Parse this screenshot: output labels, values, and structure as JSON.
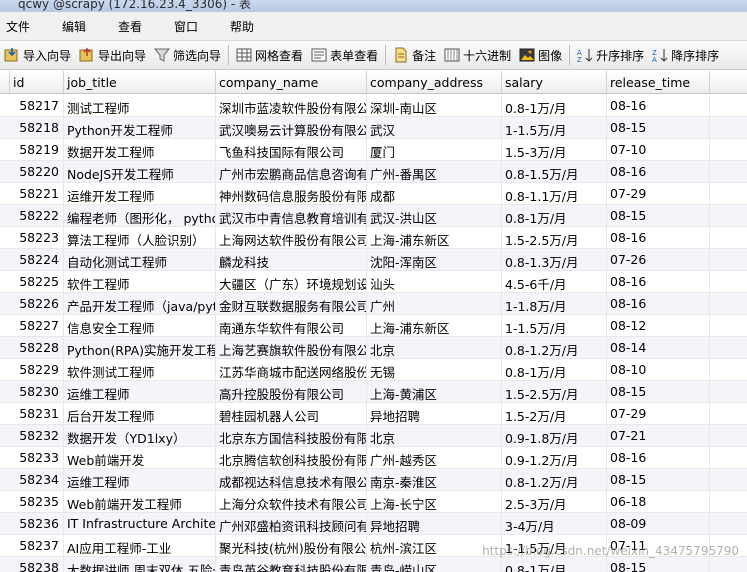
{
  "window": {
    "title": "qcwy @scrapy (172.16.23.4_3306) - 表"
  },
  "menu": [
    "文件",
    "编辑",
    "查看",
    "窗口",
    "帮助"
  ],
  "toolbar": [
    {
      "name": "import-wizard",
      "label": "导入向导",
      "icon": "import-icon"
    },
    {
      "name": "export-wizard",
      "label": "导出向导",
      "icon": "export-icon"
    },
    {
      "name": "filter-wizard",
      "label": "筛选向导",
      "icon": "filter-icon"
    },
    {
      "name": "grid-view",
      "label": "网格查看",
      "icon": "grid-icon"
    },
    {
      "name": "form-view",
      "label": "表单查看",
      "icon": "form-icon"
    },
    {
      "name": "memo",
      "label": "备注",
      "icon": "memo-icon"
    },
    {
      "name": "hex",
      "label": "十六进制",
      "icon": "hex-icon"
    },
    {
      "name": "image",
      "label": "图像",
      "icon": "image-icon"
    },
    {
      "name": "sort-asc",
      "label": "升序排序",
      "icon": "sort-asc-icon"
    },
    {
      "name": "sort-desc",
      "label": "降序排序",
      "icon": "sort-desc-icon"
    }
  ],
  "table": {
    "columns": [
      "id",
      "job_title",
      "company_name",
      "company_address",
      "salary",
      "release_time"
    ],
    "rows": [
      [
        "58217",
        "测试工程师",
        "深圳市蓝凌软件股份有限公司",
        "深圳-南山区",
        "0.8-1万/月",
        "08-16"
      ],
      [
        "58218",
        "Python开发工程师",
        "武汉噢易云计算股份有限公司",
        "武汉",
        "1-1.5万/月",
        "08-15"
      ],
      [
        "58219",
        "数据开发工程师",
        "飞鱼科技国际有限公司",
        "厦门",
        "1.5-3万/月",
        "07-10"
      ],
      [
        "58220",
        "NodeJS开发工程师",
        "广州市宏鹏商品信息咨询有限公司",
        "广州-番禺区",
        "0.8-1.5万/月",
        "08-16"
      ],
      [
        "58221",
        "运维开发工程师",
        "神州数码信息服务股份有限公司",
        "成都",
        "0.8-1.1万/月",
        "07-29"
      ],
      [
        "58222",
        "编程老师（图形化， python",
        "武汉市中青信息教育培训有限公司",
        "武汉-洪山区",
        "0.8-1万/月",
        "08-15"
      ],
      [
        "58223",
        "算法工程师（人脸识别）",
        "上海网达软件股份有限公司",
        "上海-浦东新区",
        "1.5-2.5万/月",
        "08-16"
      ],
      [
        "58224",
        "自动化测试工程师",
        "麟龙科技",
        "沈阳-浑南区",
        "0.8-1.3万/月",
        "07-26"
      ],
      [
        "58225",
        "软件工程师",
        "大疆区（广东）环境规划设计",
        "汕头",
        "4.5-6千/月",
        "08-16"
      ],
      [
        "58226",
        "产品开发工程师（java/python",
        "金财互联数据服务有限公司",
        "广州",
        "1-1.8万/月",
        "08-16"
      ],
      [
        "58227",
        "信息安全工程师",
        "南通东华软件有限公司",
        "上海-浦东新区",
        "1-1.5万/月",
        "08-12"
      ],
      [
        "58228",
        "Python(RPA)实施开发工程师",
        "上海艺赛旗软件股份有限公司",
        "北京",
        "0.8-1.2万/月",
        "08-14"
      ],
      [
        "58229",
        "软件测试工程师",
        "江苏华商城市配送网络股份有限公司",
        "无锡",
        "0.8-1万/月",
        "08-10"
      ],
      [
        "58230",
        "运维工程师",
        "高升控股股份有限公司",
        "上海-黄浦区",
        "1.5-2.5万/月",
        "08-15"
      ],
      [
        "58231",
        "后台开发工程师",
        "碧桂园机器人公司",
        "异地招聘",
        "1.5-2万/月",
        "07-29"
      ],
      [
        "58232",
        "数据开发（YD1lxy）",
        "北京东方国信科技股份有限公司",
        "北京",
        "0.9-1.8万/月",
        "07-21"
      ],
      [
        "58233",
        "Web前端开发",
        "北京腾信软创科技股份有限公司",
        "广州-越秀区",
        "0.9-1.2万/月",
        "08-16"
      ],
      [
        "58234",
        "运维工程师",
        "成都视达科信息技术有限公司",
        "南京-秦淮区",
        "0.8-1.2万/月",
        "08-15"
      ],
      [
        "58235",
        "Web前端开发工程师",
        "上海分众软件技术有限公司",
        "上海-长宁区",
        "2.5-3万/月",
        "06-18"
      ],
      [
        "58236",
        "IT Infrastructure Architect",
        "广州邓盛柏资讯科技顾问有限公司",
        "异地招聘",
        "3-4万/月",
        "08-09"
      ],
      [
        "58237",
        "AI应用工程师-工业",
        "聚光科技(杭州)股份有限公司",
        "杭州-滨江区",
        "1-1.5万/月",
        "07-11"
      ],
      [
        "58238",
        "大数据讲师 周末双休 五险一",
        "青岛英谷教育科技股份有限公司",
        "青岛-崂山区",
        "0.8-1万/月",
        "08-15"
      ]
    ]
  },
  "watermark": "https://blog.csdn.net/weixin_43475795790"
}
